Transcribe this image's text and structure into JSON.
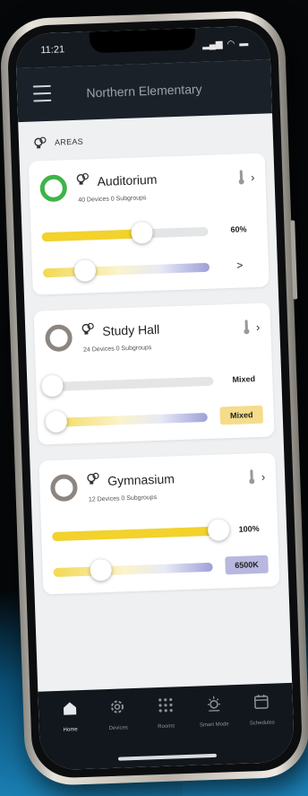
{
  "status": {
    "time": "11:21"
  },
  "header": {
    "title": "Northern Elementary"
  },
  "section": {
    "label": "AREAS"
  },
  "areas": [
    {
      "name": "Auditorium",
      "subtitle": "40 Devices 0 Subgroups",
      "on": true,
      "brightness_percent": 60,
      "brightness_label": "60%",
      "color_temp_position": 0.25,
      "color_temp_label": ">",
      "color_temp_style": "arrow"
    },
    {
      "name": "Study Hall",
      "subtitle": "24 Devices 0 Subgroups",
      "on": false,
      "brightness_percent": 0,
      "brightness_label": "Mixed",
      "color_temp_position": 0.05,
      "color_temp_label": "Mixed",
      "color_temp_style": "boxed"
    },
    {
      "name": "Gymnasium",
      "subtitle": "12 Devices 0 Subgroups",
      "on": false,
      "brightness_percent": 100,
      "brightness_label": "100%",
      "color_temp_position": 0.3,
      "color_temp_label": "6500K",
      "color_temp_style": "kelvin"
    }
  ],
  "tabs": [
    {
      "label": "Home",
      "icon": "home-icon",
      "active": true
    },
    {
      "label": "Devices",
      "icon": "gear-icon",
      "active": false
    },
    {
      "label": "Rooms",
      "icon": "grid-icon",
      "active": false
    },
    {
      "label": "Smart Mode",
      "icon": "sun-icon",
      "active": false
    },
    {
      "label": "Schedules",
      "icon": "calendar-icon",
      "active": false
    }
  ],
  "colors": {
    "on": "#3eb449",
    "off": "#8c8580",
    "brightness": "#f2d22b",
    "topbar": "#1a2129"
  }
}
